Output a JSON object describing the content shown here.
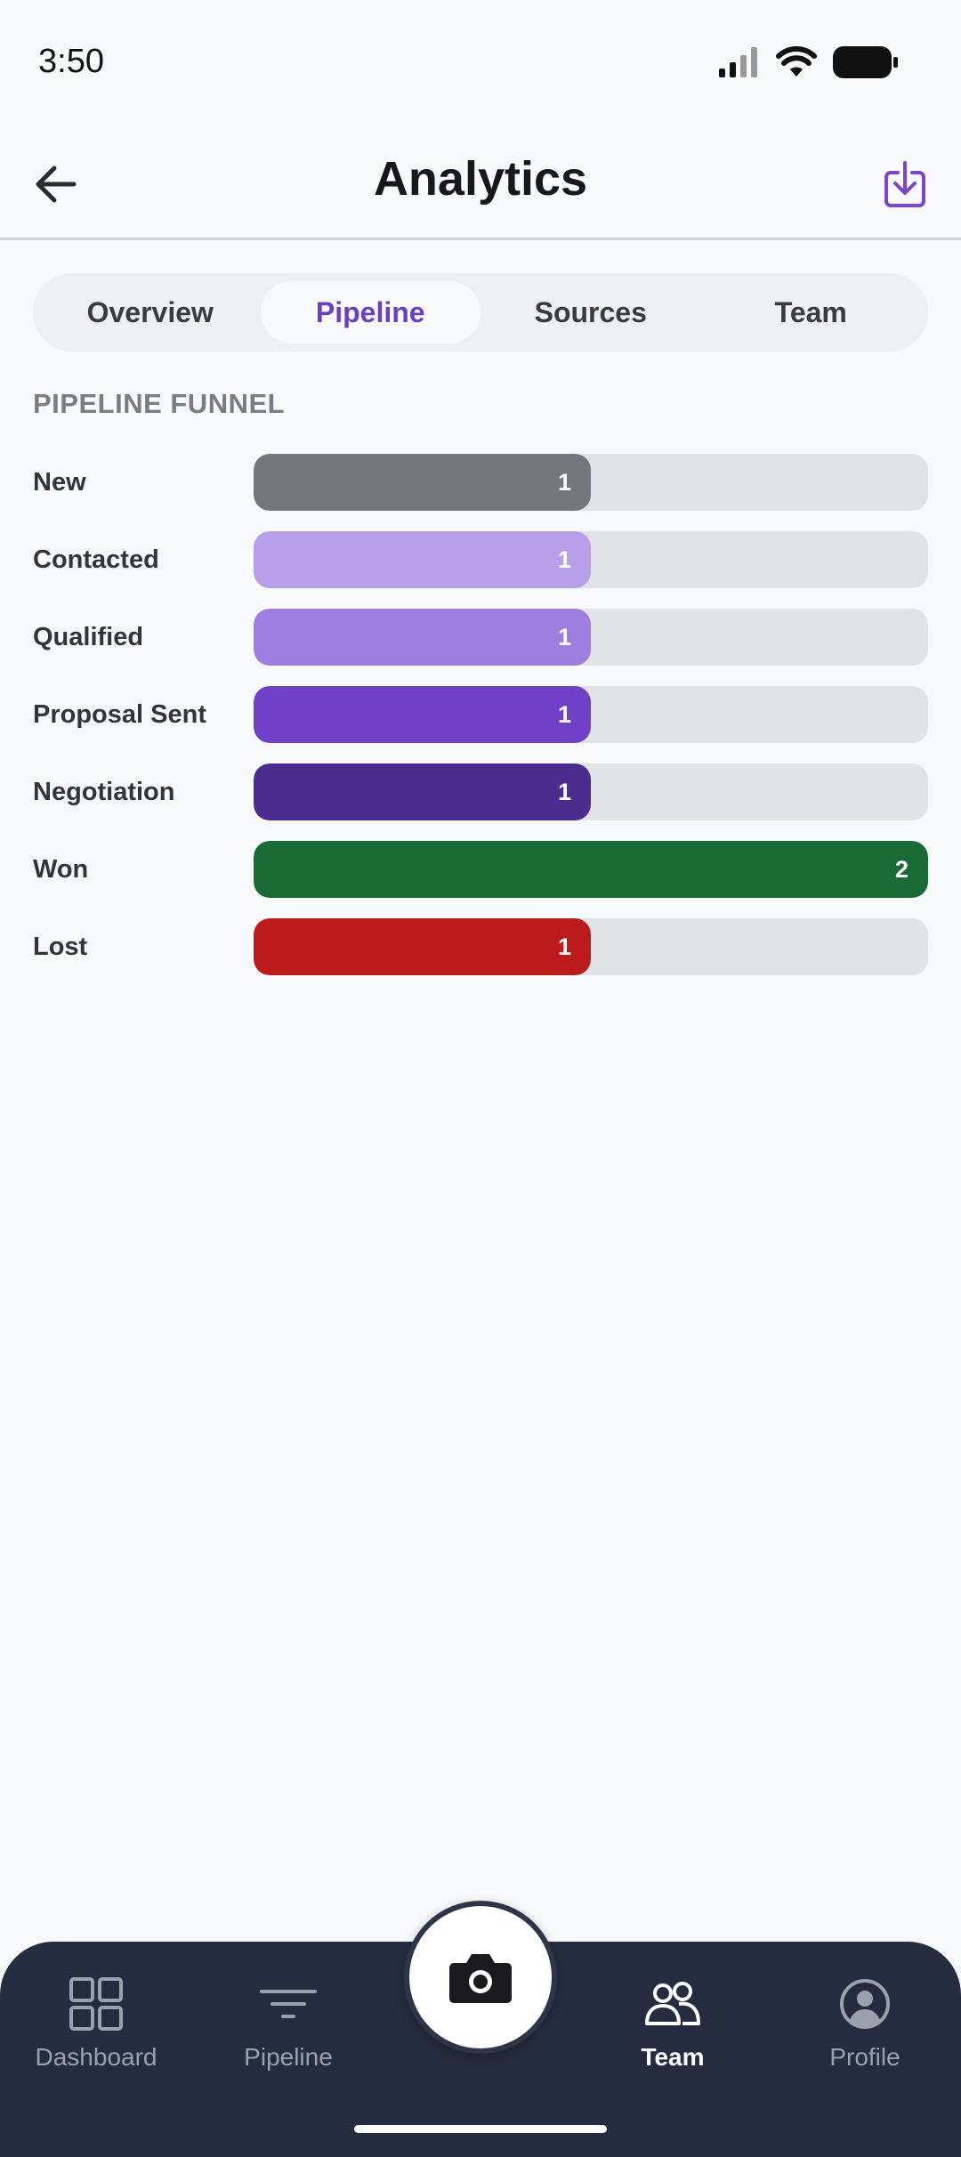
{
  "status_bar": {
    "time": "3:50"
  },
  "header": {
    "title": "Analytics"
  },
  "tabs": [
    {
      "label": "Overview",
      "active": false
    },
    {
      "label": "Pipeline",
      "active": true
    },
    {
      "label": "Sources",
      "active": false
    },
    {
      "label": "Team",
      "active": false
    }
  ],
  "section": {
    "title": "PIPELINE FUNNEL"
  },
  "chart_data": {
    "type": "bar",
    "orientation": "horizontal",
    "title": "PIPELINE FUNNEL",
    "categories": [
      "New",
      "Contacted",
      "Qualified",
      "Proposal Sent",
      "Negotiation",
      "Won",
      "Lost"
    ],
    "values": [
      1,
      1,
      1,
      1,
      1,
      2,
      1
    ],
    "colors": [
      "#76777d",
      "#b89fe9",
      "#9e7fe0",
      "#7040c8",
      "#4a2d8e",
      "#1b6b37",
      "#bd1b1b"
    ],
    "xlim": [
      0,
      2
    ]
  },
  "bottom_nav": {
    "items": [
      {
        "label": "Dashboard",
        "icon": "grid-icon",
        "active": false
      },
      {
        "label": "Pipeline",
        "icon": "filter-icon",
        "active": false
      },
      {
        "label": "Team",
        "icon": "users-icon",
        "active": true
      },
      {
        "label": "Profile",
        "icon": "user-circle-icon",
        "active": false
      }
    ],
    "fab_icon": "camera-icon"
  },
  "colors": {
    "accent": "#6a3fc2",
    "nav_bg": "#262c40",
    "track": "#e1e3e6"
  }
}
